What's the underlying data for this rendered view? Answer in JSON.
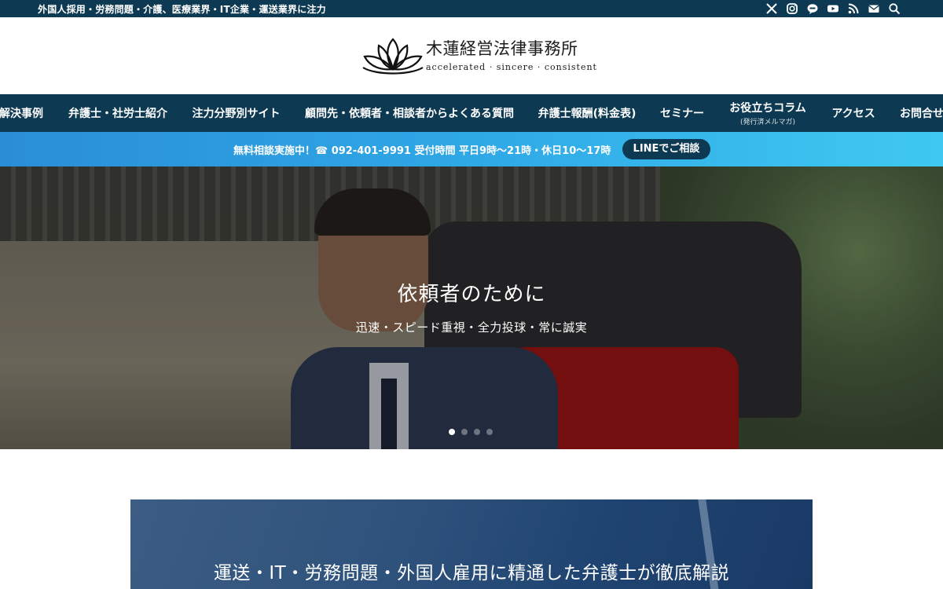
{
  "topbar": {
    "tagline": "外国人採用・労務問題・介護、医療業界・IT企業・運送業界に注力",
    "icons": [
      "x-icon",
      "instagram-icon",
      "line-icon",
      "youtube-icon",
      "rss-icon",
      "mail-icon",
      "search-icon"
    ]
  },
  "logo": {
    "title": "木蓮経営法律事務所",
    "tagline": "accelerated · sincere · consistent"
  },
  "nav": {
    "items": [
      {
        "label": "解決事例"
      },
      {
        "label": "弁護士・社労士紹介"
      },
      {
        "label": "注力分野別サイト"
      },
      {
        "label": "顧問先・依頼者・相談者からよくある質問"
      },
      {
        "label": "弁護士報酬(料金表)"
      },
      {
        "label": "セミナー"
      },
      {
        "label": "お役立ちコラム",
        "sub": "(発行済メルマガ)"
      },
      {
        "label": "アクセス"
      },
      {
        "label": "お問合せ"
      }
    ]
  },
  "infobar": {
    "text": "無料相談実施中！☎ 092-401-9991 受付時間 平日9時〜21時・休日10〜17時",
    "line_button": "LINEでご相談"
  },
  "hero": {
    "title": "依頼者のために",
    "subtitle": "迅速・スピード重視・全力投球・常に誠実",
    "slides": 4,
    "active_slide": 1
  },
  "feature": {
    "title": "運送・IT・労務問題・外国人雇用に精通した弁護士が徹底解説"
  },
  "colors": {
    "navy": "#0d3a52",
    "info_gradient_start": "#2a8ed6",
    "info_gradient_end": "#3fc9f1"
  }
}
